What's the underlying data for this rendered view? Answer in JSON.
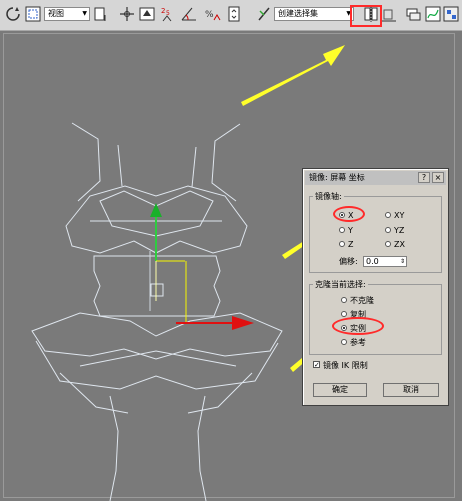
{
  "toolbar": {
    "view_dropdown": "视图",
    "selection_set_placeholder": "创建选择集",
    "icons": [
      "rotate-icon",
      "select-region-icon",
      "view-dropdown",
      "pivot-icon",
      "move-icon",
      "select-manipulate-icon",
      "snap-2-5-icon",
      "angle-snap-icon",
      "percent-snap-icon",
      "spinner-snap-icon",
      "edit-named-selection-icon",
      "selection-set-dropdown",
      "mirror-icon",
      "align-icon",
      "layer-manager-icon",
      "curve-editor-icon",
      "schematic-view-icon"
    ]
  },
  "dialog": {
    "title": "镜像: 屏幕 坐标",
    "help_button": "?",
    "close_button": "×",
    "mirror_axis_label": "镜像轴:",
    "axes": [
      {
        "label": "X",
        "selected": true
      },
      {
        "label": "XY",
        "selected": false
      },
      {
        "label": "Y",
        "selected": false
      },
      {
        "label": "YZ",
        "selected": false
      },
      {
        "label": "Z",
        "selected": false
      },
      {
        "label": "ZX",
        "selected": false
      }
    ],
    "offset_label": "偏移:",
    "offset_value": "0.0",
    "clone_label": "克隆当前选择:",
    "clone_options": [
      {
        "label": "不克隆",
        "selected": false
      },
      {
        "label": "复制",
        "selected": false
      },
      {
        "label": "实例",
        "selected": true
      },
      {
        "label": "参考",
        "selected": false
      }
    ],
    "mirror_ik_label": "镜像 IK 限制",
    "mirror_ik_checked": true,
    "ok_label": "确定",
    "cancel_label": "取消"
  },
  "annotation_color": "#ff2a2a",
  "arrow_color": "#ffff2a"
}
